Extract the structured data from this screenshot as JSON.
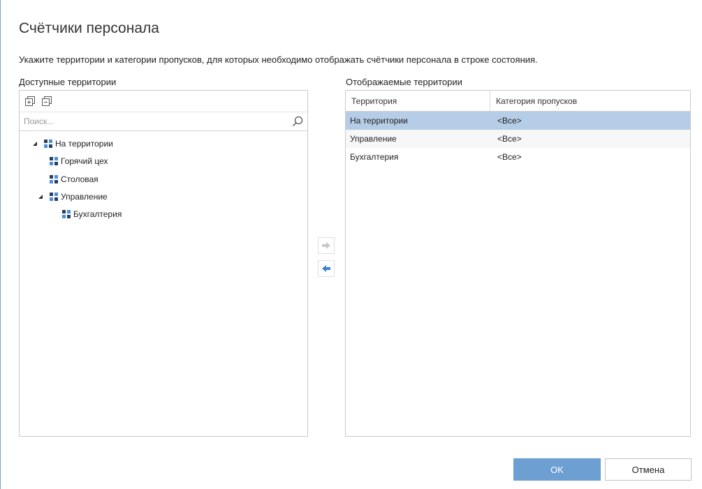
{
  "dialog": {
    "title": "Счётчики персонала",
    "instruction": "Укажите территории и категории пропусков, для которых необходимо отображать счётчики персонала в строке состояния."
  },
  "available": {
    "label": "Доступные территории",
    "search": {
      "placeholder": "Поиск...",
      "value": ""
    },
    "tree": [
      {
        "label": "На территории",
        "level": 0,
        "expanded": true,
        "has_children": true
      },
      {
        "label": "Горячий цех",
        "level": 1,
        "expanded": false,
        "has_children": false
      },
      {
        "label": "Столовая",
        "level": 1,
        "expanded": false,
        "has_children": false
      },
      {
        "label": "Управление",
        "level": 1,
        "expanded": true,
        "has_children": true
      },
      {
        "label": "Бухгалтерия",
        "level": 2,
        "expanded": false,
        "has_children": false
      }
    ]
  },
  "displayed": {
    "label": "Отображаемые территории",
    "columns": [
      "Территория",
      "Категория пропусков"
    ],
    "rows": [
      {
        "territory": "На территории",
        "category": "<Все>",
        "selected": true
      },
      {
        "territory": "Управление",
        "category": "<Все>",
        "selected": false
      },
      {
        "territory": "Бухгалтерия",
        "category": "<Все>",
        "selected": false
      }
    ]
  },
  "footer": {
    "ok_label": "OK",
    "cancel_label": "Отмена"
  },
  "colors": {
    "accent": "#6d9fd3",
    "selected_row": "#b5cde6",
    "node_icon_dark": "#2a3f5f",
    "node_icon_light": "#4a90d9",
    "arrow_active": "#3b82d0",
    "arrow_disabled": "#c8c8c8"
  },
  "icons": {
    "expand_all": "expand-all-icon",
    "collapse_all": "collapse-all-icon",
    "search": "search-icon",
    "add": "arrow-right-icon",
    "remove": "arrow-left-icon",
    "node": "territory-icon",
    "expander": "triangle-expanded-icon"
  }
}
